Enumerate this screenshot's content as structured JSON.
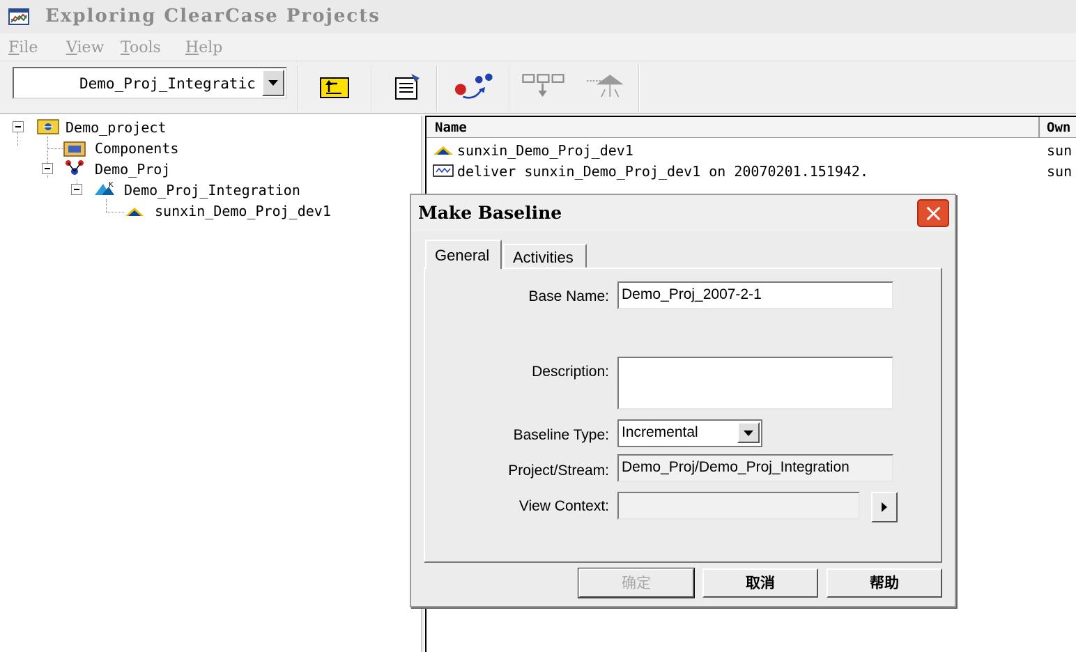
{
  "window": {
    "title": "Exploring ClearCase Projects",
    "icon": "chart-window-icon"
  },
  "menu": {
    "file": {
      "mnemonic": "F",
      "rest": "ile"
    },
    "view": {
      "mnemonic": "V",
      "rest": "iew"
    },
    "tools": {
      "mnemonic": "T",
      "rest": "ools"
    },
    "help": {
      "mnemonic": "H",
      "rest": "elp"
    }
  },
  "toolbar": {
    "project_combo_value": "Demo_Proj_Integratic"
  },
  "tree": {
    "root": "Demo_project",
    "components": "Components",
    "project": "Demo_Proj",
    "integration_stream": "Demo_Proj_Integration",
    "dev_stream": "sunxin_Demo_Proj_dev1"
  },
  "list": {
    "columns": {
      "name": "Name",
      "owner": "Own"
    },
    "rows": [
      {
        "name": "sunxin_Demo_Proj_dev1",
        "owner": "sun"
      },
      {
        "name": "deliver sunxin_Demo_Proj_dev1 on 20070201.151942.",
        "owner": "sun"
      }
    ]
  },
  "dialog": {
    "title": "Make Baseline",
    "tabs": {
      "general": "General",
      "activities": "Activities"
    },
    "labels": {
      "base_name": "Base Name:",
      "description": "Description:",
      "baseline_type": "Baseline Type:",
      "project_stream": "Project/Stream:",
      "view_context": "View Context:"
    },
    "values": {
      "base_name": "Demo_Proj_2007-2-1",
      "description": "",
      "baseline_type": "Incremental",
      "project_stream": "Demo_Proj/Demo_Proj_Integration",
      "view_context": ""
    },
    "buttons": {
      "ok": "确定",
      "cancel": "取消",
      "help": "帮助"
    }
  },
  "colors": {
    "close_button": "#e0502e",
    "title_text_disabled": "#8a8a8a"
  }
}
